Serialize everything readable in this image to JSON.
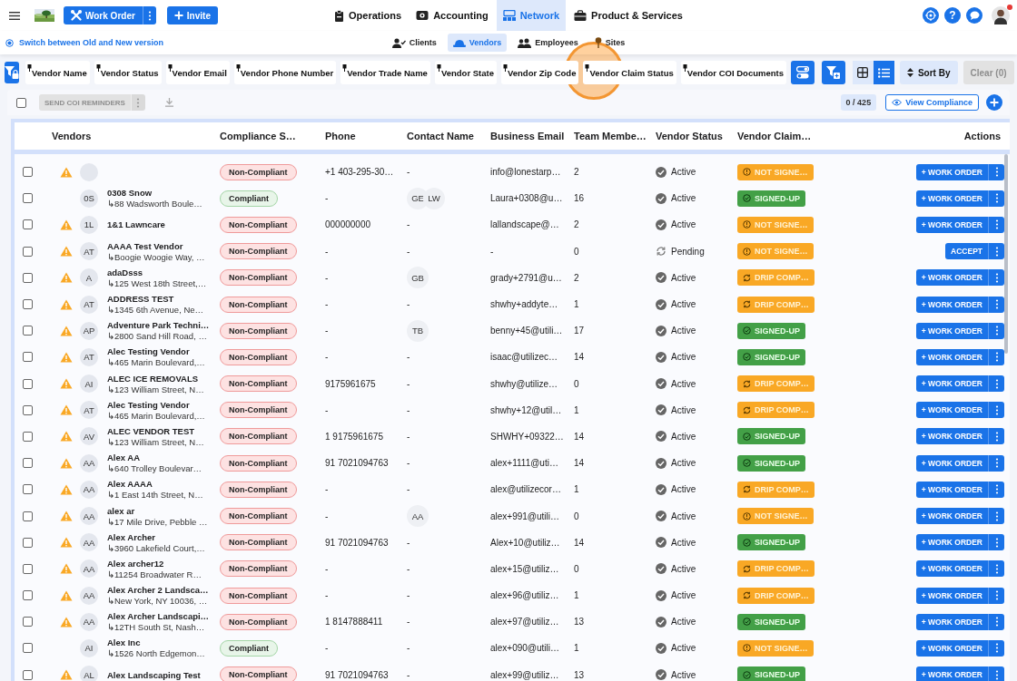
{
  "top_bar": {
    "work_order_button": "Work Order",
    "invite_button": "Invite",
    "nav_tabs": [
      {
        "label": "Operations",
        "selected": false
      },
      {
        "label": "Accounting",
        "selected": false
      },
      {
        "label": "Network",
        "selected": true
      },
      {
        "label": "Product & Services",
        "selected": false
      }
    ],
    "help_button": "?",
    "notification": true
  },
  "sub_nav": {
    "version_switch": "Switch between Old and New version",
    "tabs": [
      {
        "label": "Clients",
        "selected": false
      },
      {
        "label": "Vendors",
        "selected": true
      },
      {
        "label": "Employees",
        "selected": false
      },
      {
        "label": "Sites",
        "selected": false
      }
    ]
  },
  "filter_chips": [
    "Vendor Name",
    "Vendor Status",
    "Vendor Email",
    "Vendor Phone Number",
    "Vendor Trade Name",
    "Vendor State",
    "Vendor Zip Code",
    "Vendor Claim Status",
    "Vendor COI Documents"
  ],
  "view_toggle": [
    {
      "kind": "grid",
      "selected": false
    },
    {
      "kind": "list",
      "selected": true
    }
  ],
  "sort_button": "Sort By",
  "clear_button": {
    "label": "Clear (0)",
    "disabled": true
  },
  "toolbar": {
    "select_all": false,
    "reminder_button": {
      "label": "SEND COI REMINDERS",
      "disabled": true
    },
    "count": "0 / 425",
    "view_compliance_button": "View Compliance"
  },
  "table": {
    "columns": [
      "Vendors",
      "Compliance S…",
      "Phone",
      "Contact Name",
      "Business Email",
      "Team Membe…",
      "Vendor Status",
      "Vendor Claim…",
      "Actions"
    ],
    "rows": [
      {
        "checked": false,
        "warning": true,
        "compliant": false,
        "compliance": "Non-Compliant",
        "phone": "+1 403-295-30…",
        "contact": "-",
        "email": "info@lonestarp…",
        "team": "2",
        "status": {
          "kind": "active",
          "label": "Active"
        },
        "claim": {
          "kind": "not_signed",
          "label": "NOT SIGNE…"
        },
        "action": "+ WORK ORDER"
      },
      {
        "checked": false,
        "warning": false,
        "initials": "0S",
        "name": "0308 Snow",
        "address": "↳88 Wadsworth Boule…",
        "compliant": true,
        "compliance": "Compliant",
        "phone": "-",
        "contacts": [
          "GE",
          "LW"
        ],
        "email": "Laura+0308@u…",
        "team": "16",
        "status": {
          "kind": "active",
          "label": "Active"
        },
        "claim": {
          "kind": "signed",
          "label": "SIGNED-UP"
        },
        "action": "+ WORK ORDER"
      },
      {
        "checked": false,
        "warning": true,
        "initials": "1L",
        "name": "1&1 Lawncare",
        "compliant": false,
        "compliance": "Non-Compliant",
        "phone": "000000000",
        "contact": "-",
        "email": "lallandscape@…",
        "team": "2",
        "status": {
          "kind": "active",
          "label": "Active"
        },
        "claim": {
          "kind": "not_signed",
          "label": "NOT SIGNE…"
        },
        "action": "+ WORK ORDER"
      },
      {
        "checked": false,
        "warning": true,
        "initials": "AT",
        "name": "AAAA Test Vendor",
        "address": "↳Boogie Woogie Way, …",
        "compliant": false,
        "compliance": "Non-Compliant",
        "phone": "-",
        "contact": "-",
        "email": "-",
        "team": "0",
        "status": {
          "kind": "pending",
          "label": "Pending"
        },
        "claim": {
          "kind": "not_signed",
          "label": "NOT SIGNE…"
        },
        "action": "ACCEPT"
      },
      {
        "checked": false,
        "warning": true,
        "initials": "A",
        "name": "adaDsss",
        "address": "↳125 West 18th Street,…",
        "compliant": false,
        "compliance": "Non-Compliant",
        "phone": "-",
        "contacts": [
          "GB"
        ],
        "email": "grady+2791@u…",
        "team": "2",
        "status": {
          "kind": "active",
          "label": "Active"
        },
        "claim": {
          "kind": "drip",
          "label": "DRIP COMP…"
        },
        "action": "+ WORK ORDER"
      },
      {
        "checked": false,
        "warning": true,
        "initials": "AT",
        "name": "ADDRESS TEST",
        "address": "↳1345 6th Avenue, Ne…",
        "compliant": false,
        "compliance": "Non-Compliant",
        "phone": "-",
        "contact": "-",
        "email": "shwhy+addyte…",
        "team": "1",
        "status": {
          "kind": "active",
          "label": "Active"
        },
        "claim": {
          "kind": "drip",
          "label": "DRIP COMP…"
        },
        "action": "+ WORK ORDER"
      },
      {
        "checked": false,
        "warning": true,
        "initials": "AP",
        "name": "Adventure Park Techni…",
        "address": "↳2800 Sand Hill Road, …",
        "compliant": false,
        "compliance": "Non-Compliant",
        "phone": "-",
        "contacts": [
          "TB"
        ],
        "email": "benny+45@utili…",
        "team": "17",
        "status": {
          "kind": "active",
          "label": "Active"
        },
        "claim": {
          "kind": "signed",
          "label": "SIGNED-UP"
        },
        "action": "+ WORK ORDER"
      },
      {
        "checked": false,
        "warning": true,
        "initials": "AT",
        "name": "Alec Testing Vendor",
        "address": "↳465 Marin Boulevard,…",
        "compliant": false,
        "compliance": "Non-Compliant",
        "phone": "-",
        "contact": "-",
        "email": "isaac@utilizec…",
        "team": "14",
        "status": {
          "kind": "active",
          "label": "Active"
        },
        "claim": {
          "kind": "signed",
          "label": "SIGNED-UP"
        },
        "action": "+ WORK ORDER"
      },
      {
        "checked": false,
        "warning": true,
        "initials": "AI",
        "name": "ALEC ICE REMOVALS",
        "address": "↳123 William Street, N…",
        "compliant": false,
        "compliance": "Non-Compliant",
        "phone": "9175961675",
        "contact": "-",
        "email": "shwhy@utilize…",
        "team": "0",
        "status": {
          "kind": "active",
          "label": "Active"
        },
        "claim": {
          "kind": "drip",
          "label": "DRIP COMP…"
        },
        "action": "+ WORK ORDER"
      },
      {
        "checked": false,
        "warning": true,
        "initials": "AT",
        "name": "Alec Testing Vendor",
        "address": "↳465 Marin Boulevard,…",
        "compliant": false,
        "compliance": "Non-Compliant",
        "phone": "-",
        "contact": "-",
        "email": "shwhy+12@util…",
        "team": "1",
        "status": {
          "kind": "active",
          "label": "Active"
        },
        "claim": {
          "kind": "drip",
          "label": "DRIP COMP…"
        },
        "action": "+ WORK ORDER"
      },
      {
        "checked": false,
        "warning": true,
        "initials": "AV",
        "name": "ALEC VENDOR TEST",
        "address": "↳123 William Street, N…",
        "compliant": false,
        "compliance": "Non-Compliant",
        "phone": "1 9175961675",
        "contact": "-",
        "email": "SHWHY+09322…",
        "team": "14",
        "status": {
          "kind": "active",
          "label": "Active"
        },
        "claim": {
          "kind": "signed",
          "label": "SIGNED-UP"
        },
        "action": "+ WORK ORDER"
      },
      {
        "checked": false,
        "warning": true,
        "initials": "AA",
        "name": "Alex AA",
        "address": "↳640 Trolley Boulevar…",
        "compliant": false,
        "compliance": "Non-Compliant",
        "phone": "91 7021094763",
        "contact": "-",
        "email": "alex+1111@uti…",
        "team": "14",
        "status": {
          "kind": "active",
          "label": "Active"
        },
        "claim": {
          "kind": "signed",
          "label": "SIGNED-UP"
        },
        "action": "+ WORK ORDER"
      },
      {
        "checked": false,
        "warning": true,
        "initials": "AA",
        "name": "Alex AAAA",
        "address": "↳1 East 14th Street, N…",
        "compliant": false,
        "compliance": "Non-Compliant",
        "phone": "-",
        "contact": "-",
        "email": "alex@utilizecor…",
        "team": "1",
        "status": {
          "kind": "active",
          "label": "Active"
        },
        "claim": {
          "kind": "drip",
          "label": "DRIP COMP…"
        },
        "action": "+ WORK ORDER"
      },
      {
        "checked": false,
        "warning": true,
        "initials": "AA",
        "name": "alex ar",
        "address": "↳17 Mile Drive, Pebble …",
        "compliant": false,
        "compliance": "Non-Compliant",
        "phone": "-",
        "contacts": [
          "AA"
        ],
        "email": "alex+991@utili…",
        "team": "0",
        "status": {
          "kind": "active",
          "label": "Active"
        },
        "claim": {
          "kind": "not_signed",
          "label": "NOT SIGNE…"
        },
        "action": "+ WORK ORDER"
      },
      {
        "checked": false,
        "warning": true,
        "initials": "AA",
        "name": "Alex Archer",
        "address": "↳3960 Lakefield Court,…",
        "compliant": false,
        "compliance": "Non-Compliant",
        "phone": "91 7021094763",
        "contact": "-",
        "email": "Alex+10@utiliz…",
        "team": "14",
        "status": {
          "kind": "active",
          "label": "Active"
        },
        "claim": {
          "kind": "signed",
          "label": "SIGNED-UP"
        },
        "action": "+ WORK ORDER"
      },
      {
        "checked": false,
        "warning": true,
        "initials": "AA",
        "name": "Alex archer12",
        "address": "↳11254 Broadwater R…",
        "compliant": false,
        "compliance": "Non-Compliant",
        "phone": "-",
        "contact": "-",
        "email": "alex+15@utiliz…",
        "team": "0",
        "status": {
          "kind": "active",
          "label": "Active"
        },
        "claim": {
          "kind": "drip",
          "label": "DRIP COMP…"
        },
        "action": "+ WORK ORDER"
      },
      {
        "checked": false,
        "warning": true,
        "initials": "AA",
        "name": "Alex Archer 2 Landsca…",
        "address": "↳New York, NY 10036, …",
        "compliant": false,
        "compliance": "Non-Compliant",
        "phone": "-",
        "contact": "-",
        "email": "alex+96@utiliz…",
        "team": "1",
        "status": {
          "kind": "active",
          "label": "Active"
        },
        "claim": {
          "kind": "drip",
          "label": "DRIP COMP…"
        },
        "action": "+ WORK ORDER"
      },
      {
        "checked": false,
        "warning": true,
        "initials": "AA",
        "name": "Alex Archer Landscapi…",
        "address": "↳12TH South St, Nash…",
        "compliant": false,
        "compliance": "Non-Compliant",
        "phone": "1 8147888411",
        "contact": "-",
        "email": "alex+97@utiliz…",
        "team": "13",
        "status": {
          "kind": "active",
          "label": "Active"
        },
        "claim": {
          "kind": "signed",
          "label": "SIGNED-UP"
        },
        "action": "+ WORK ORDER"
      },
      {
        "checked": false,
        "warning": false,
        "initials": "AI",
        "name": "Alex Inc",
        "address": "↳1526 North Edgemon…",
        "compliant": true,
        "compliance": "Compliant",
        "phone": "-",
        "contact": "-",
        "email": "alex+090@utili…",
        "team": "1",
        "status": {
          "kind": "active",
          "label": "Active"
        },
        "claim": {
          "kind": "not_signed",
          "label": "NOT SIGNE…"
        },
        "action": "+ WORK ORDER"
      },
      {
        "checked": false,
        "warning": true,
        "initials": "AL",
        "name": "Alex Landscaping Test",
        "compliant": false,
        "compliance": "Non-Compliant",
        "phone": "91 7021094763",
        "contact": "-",
        "email": "alex+99@utiliz…",
        "team": "13",
        "status": {
          "kind": "active",
          "label": "Active"
        },
        "claim": {
          "kind": "signed",
          "label": "SIGNED-UP"
        },
        "action": "+ WORK ORDER"
      }
    ]
  }
}
